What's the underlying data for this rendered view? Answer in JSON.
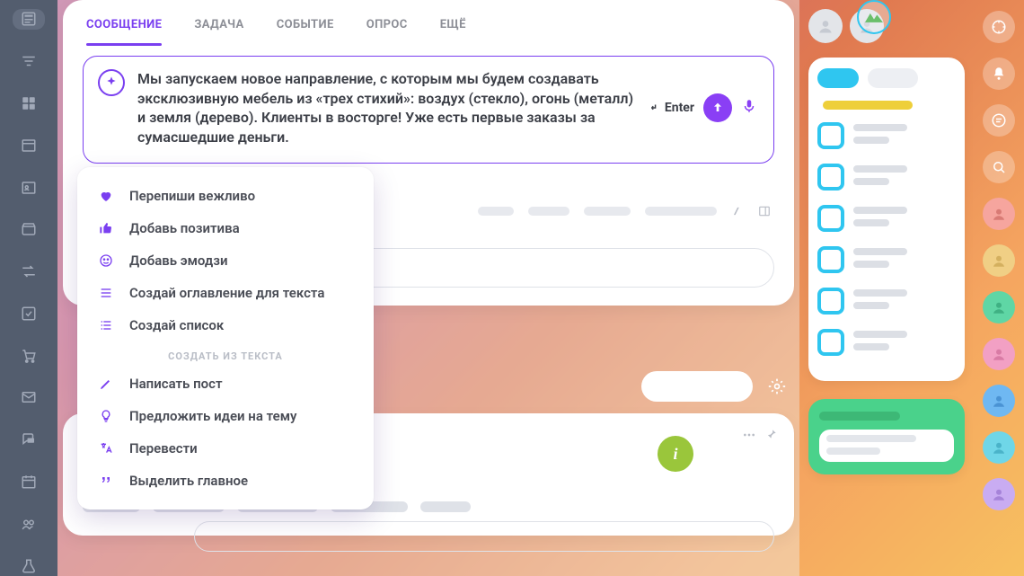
{
  "tabs": {
    "message": "СООБЩЕНИЕ",
    "task": "ЗАДАЧА",
    "event": "СОБЫТИЕ",
    "poll": "ОПРОС",
    "more": "ЕЩЁ"
  },
  "composer": {
    "text": "Мы запускаем новое направление, с которым мы будем создавать эксклюзивную мебель из  «трех стихий»: воздух (стекло), огонь (металл) и земля (дерево). Клиенты в  восторге! Уже есть первые заказы за сумасшедшие деньги.",
    "enter_hint": "Enter"
  },
  "ai_menu": {
    "items": [
      {
        "icon": "heart",
        "label": "Перепиши вежливо"
      },
      {
        "icon": "thumb",
        "label": "Добавь позитива"
      },
      {
        "icon": "smile",
        "label": "Добавь эмодзи"
      },
      {
        "icon": "list",
        "label": "Создай оглавление для текста"
      },
      {
        "icon": "list-num",
        "label": "Создай список"
      }
    ],
    "section_label": "СОЗДАТЬ ИЗ ТЕКСТА",
    "items2": [
      {
        "icon": "pencil",
        "label": "Написать пост"
      },
      {
        "icon": "bulb",
        "label": "Предложить идеи на тему"
      },
      {
        "icon": "lang",
        "label": "Перевести"
      },
      {
        "icon": "quote",
        "label": "Выделить главное"
      }
    ]
  },
  "feed": {
    "info_glyph": "i"
  },
  "colors": {
    "accent": "#7a3ff0",
    "send": "#8a3ff5",
    "cyan": "#2fc6f0",
    "yellow": "#eecf3a",
    "green": "#4ad28b",
    "info": "#9ac63b"
  },
  "rail_right_colors": [
    "#bfc4cd",
    "#bfc4cd",
    "#bfc4cd",
    "#bfc4cd",
    "#f6a59e",
    "#f0cf85",
    "#5fd6a5",
    "#f2a0c4",
    "#6fb8f2",
    "#6fd6e8",
    "#c9acf2"
  ],
  "right_list_count": 6
}
